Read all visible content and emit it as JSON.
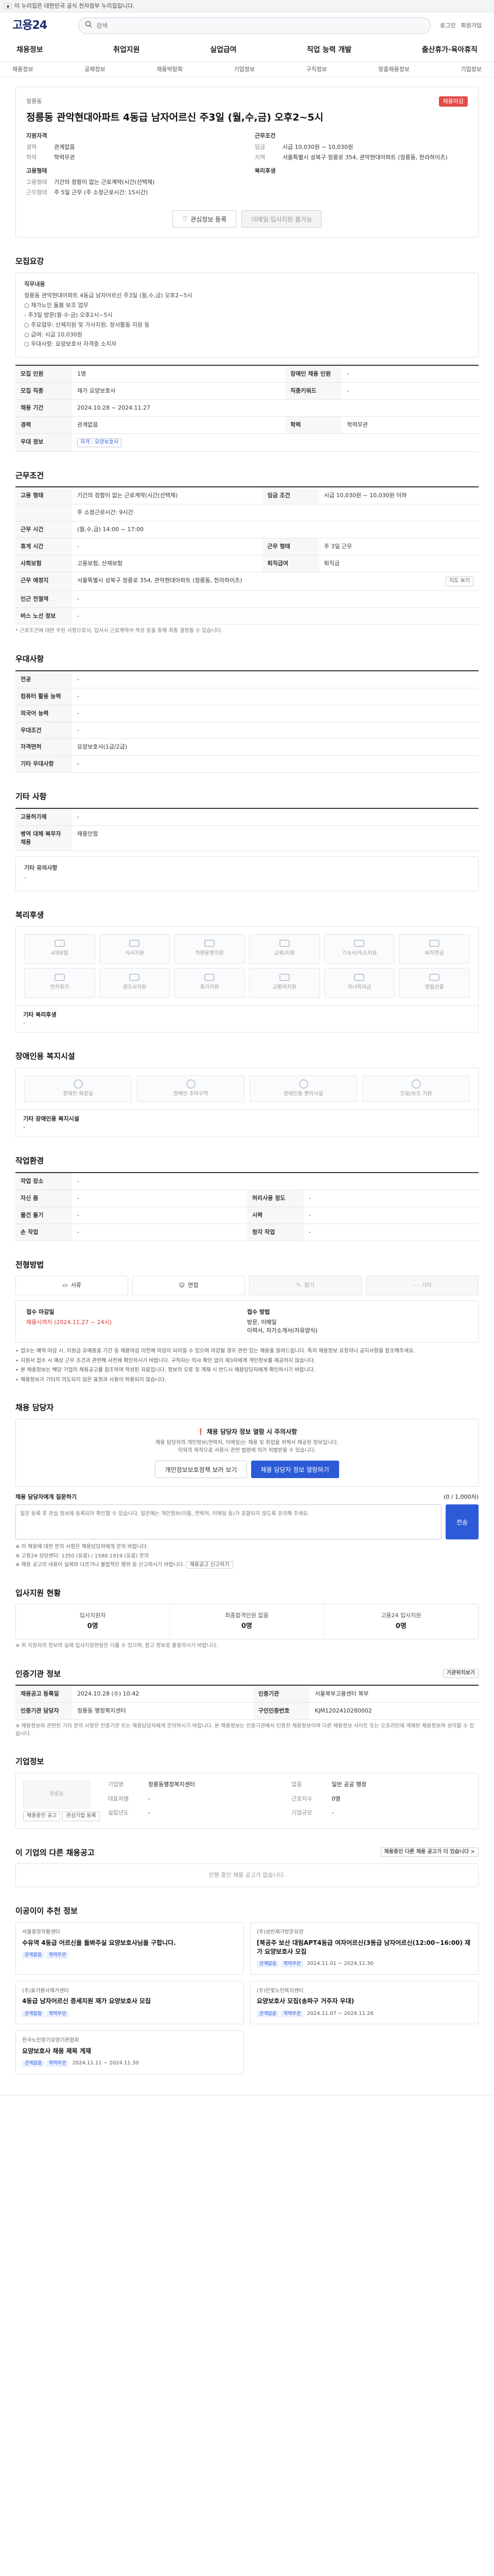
{
  "banner": {
    "text": "이 누리집은 대한민국 공식 전자정부 누리집입니다."
  },
  "header": {
    "logo": "고용24",
    "search_placeholder": "검색",
    "search_value": "",
    "util": [
      "로그인",
      "회원가입"
    ]
  },
  "gnb": [
    "채용정보",
    "취업지원",
    "실업급여",
    "직업 능력 개발",
    "출산휴가·육아휴직"
  ],
  "subnav": [
    "채용정보",
    "공채정보",
    "채용박람회",
    "기업정보",
    "구직정보",
    "맞춤채용정보",
    "기업정보"
  ],
  "job": {
    "org_name": "정릉동",
    "status": "채용마감",
    "title": "정릉동 관악현대아파트 4동급 남자어르신 주3일 (월,수,금) 오후2~5시",
    "left": {
      "heading1": "지원자격",
      "rows1": [
        {
          "k": "경력",
          "v": "관계없음"
        },
        {
          "k": "학력",
          "v": "학력무관"
        }
      ],
      "heading2": "고용형태",
      "rows2": [
        {
          "k": "고용형태",
          "v": "기간의 정함이 없는 근로계약(시간(선택제)"
        },
        {
          "k": "근무형태",
          "v": "주 5일 근무 (주 소정근로시간: 15시간)"
        }
      ]
    },
    "right": {
      "heading1": "근무조건",
      "rows1": [
        {
          "k": "임금",
          "v": "시급 10,030원 ~ 10,030원"
        },
        {
          "k": "지역",
          "v": "서울특별시 성북구 정릉로 354, 관악현대아파트 (정릉동, 한라하이츠)"
        }
      ],
      "heading2": "복리후생",
      "rows2": []
    },
    "btn_scrap": "관심정보 등록",
    "btn_apply": "이메일·입사지원 불가능"
  },
  "recruit": {
    "title": "모집요강",
    "duty_title": "직무내용",
    "duty_lines": [
      "정릉동 관악현대아파트 4동급 남자어르신 주3일 (월,수,금) 오후2~5시",
      "○ 재가노인 돌봄 보조 업무",
      "  - 주3일 방문(월·수·금) 오후2시~5시",
      "○ 주요업무: 신체지원 및 가사지원, 정서활동 지원 등",
      "○ 급여: 시급 10,030원",
      "○ 우대사항: 요양보호사 자격증 소지자"
    ],
    "rows": [
      {
        "k": "모집 인원",
        "v": "1명",
        "k2": "장애인 채용 인원",
        "v2": "-"
      },
      {
        "k": "모집 직종",
        "v": "재가 요양보호사",
        "k2": "직종키워드",
        "v2": "-"
      },
      {
        "k": "채용 기간",
        "v": "2024.10.28 ~ 2024.11.27",
        "k2": "",
        "v2": ""
      },
      {
        "k": "경력",
        "v": "관계없음",
        "k2": "학력",
        "v2": "학력무관"
      },
      {
        "k": "우대 정보",
        "v": "자격 : 요양보호사",
        "k2": "",
        "v2": ""
      }
    ]
  },
  "conditions": {
    "title": "근무조건",
    "rows": [
      {
        "k": "고용 형태",
        "v": "기간의 정함이 없는 근로계약(시간(선택제)",
        "k2": "임금 조건",
        "v2": "시급 10,030원 ~ 10,030원 이하"
      },
      {
        "k": "",
        "v": "주 소정근로시간: 9시간",
        "k2": "",
        "v2": ""
      },
      {
        "k": "근무 시간",
        "v": "(월,수,금) 14:00 ~ 17:00",
        "k2": "",
        "v2": ""
      },
      {
        "k": "휴게 시간",
        "v": "-",
        "k2": "근무 형태",
        "v2": "주 3일 근무"
      },
      {
        "k": "사회보험",
        "v": "고용보험, 산재보험",
        "k2": "퇴직급여",
        "v2": "퇴직금"
      },
      {
        "k": "근무 예정지",
        "v": "서울특별시 성북구 정릉로 354, 관악현대아파트 (정릉동, 한라하이츠)",
        "k2": "",
        "v2": ""
      },
      {
        "k": "인근 전철역",
        "v": "-",
        "k2": "",
        "v2": ""
      },
      {
        "k": "버스 노선 정보",
        "v": "-",
        "k2": "",
        "v2": ""
      }
    ],
    "map_btn": "지도 보기",
    "note": "* 근로조건에 대한 주된 사항으로서, 입사시 근로계약서 작성 등을 통해 최종 결정될 수 있습니다."
  },
  "extra": {
    "title": "우대사항",
    "rows": [
      {
        "k": "전공",
        "v": "-"
      },
      {
        "k": "컴퓨터 활용 능력",
        "v": "-"
      },
      {
        "k": "외국어 능력",
        "v": "-"
      },
      {
        "k": "우대조건",
        "v": "-"
      },
      {
        "k": "자격면허",
        "v": "요양보호사(1급/2급)"
      },
      {
        "k": "기타 우대사항",
        "v": "-"
      }
    ]
  },
  "etc": {
    "title": "기타 사항",
    "rows": [
      {
        "k": "고용허가제",
        "v": "-"
      },
      {
        "k": "병역 대체 복무자 채용",
        "v": "채용안함"
      }
    ],
    "memo_title": "기타 유의사항",
    "memo": "-"
  },
  "welfare": {
    "title": "복리후생",
    "items": [
      "4대보험",
      "식사지원",
      "차량운행지원",
      "교육/지원",
      "기숙사/숙소지원",
      "퇴직연금",
      "연차휴가",
      "경조사지원",
      "휴가지원",
      "교통비지원",
      "자녀학자금",
      "명절선물"
    ],
    "other_label": "기타 복리후생",
    "other_value": "-"
  },
  "disability": {
    "title": "장애인용 복지시설",
    "items": [
      "장애인 화장실",
      "장애인 주차구역",
      "장애인용 편의시설",
      "진료/보조 지원"
    ],
    "other_label": "기타 장애인용 복지시설",
    "other_value": "-"
  },
  "workenv": {
    "title": "작업환경",
    "rows": [
      {
        "k": "작업 장소",
        "v": "-",
        "k2": "",
        "v2": ""
      },
      {
        "k": "자신 몸",
        "v": "-",
        "k2": "허리사용 정도",
        "v2": "-"
      },
      {
        "k": "물건 들기",
        "v": "-",
        "k2": "시력",
        "v2": "-"
      },
      {
        "k": "손 작업",
        "v": "-",
        "k2": "청각 작업",
        "v2": "-"
      }
    ]
  },
  "apply": {
    "title": "전형방법",
    "chips": [
      {
        "label": "서류",
        "on": true
      },
      {
        "label": "면접",
        "on": true
      },
      {
        "label": "필기",
        "on": false
      },
      {
        "label": "기타",
        "on": false
      }
    ],
    "deadline_label": "접수 마감일",
    "deadline_value": "채용시까지 (2024.11.27 ~ 24시)",
    "method_label": "접수 방법",
    "method_value": "방문, 이메일",
    "method_sub": "이력서, 자기소개서(자유양식)",
    "notes": [
      "접수는 예약 마감 시, 지원금 유예종료 기간 등 채용마감 이전에 마감이 되어질 수 있으며 마감될 경우 관련 있는 채용을 알려드립니다. 특히 채용정보 요청자나 공지사항을 참조해주세요.",
      "지원서 접수 시 예상 근무 조건과 관련해 사전에 확인하시기 바랍니다. 구직자는 의사 확인 없이 제3자에게 개인정보를 제공하지 않습니다.",
      "본 채용정보는 해당 기업의 채용공고를 참조하여 작성된 자료입니다. 정보의 오류 및 게재 시 반드시 채용담당자에게 확인하시기 바랍니다.",
      "채용정보가 기타의 의도되지 않은 표현과 사용이 허용되지 않습니다."
    ]
  },
  "contact": {
    "title": "채용 담당자",
    "warn": "채용 담당자 정보 열람 시 주의사항",
    "sub1": "채용 담당자의 개인정보(연락처, 이메일)는 채용 및 취업을 위해서 제공된 정보입니다.",
    "sub2": "이외의 목적으로 사용시 관련 법령에 의거 처벌받을 수 있습니다.",
    "btn_contact": "개인정보보호정책 보러 보기",
    "btn_show": "채용 담당자 정보 열람하기",
    "qna_label": "채용 담당자에게 질문하기",
    "qna_count": "(0 / 1,000자)",
    "qna_placeholder": "질문 등록 후 관심 정보에 등록되어 확인할 수 있습니다. 질문에는 개인정보(이름, 연락처, 이메일 등)가 포함되지 않도록 유의해 주세요.",
    "qna_submit": "전송",
    "notes": [
      "※ 이 채용에 대한 문의 사항은 채용담당자에게 문의 바랍니다.",
      "※ 고용24 상담센터: 1350 (유료) / 1588-1919 (유료) 문의",
      "※ 채용 공고의 내용이 실제와 다르거나 불법적인 행위 등 신고하시기 바랍니다."
    ],
    "report_btn": "채용공고 신고하기"
  },
  "status": {
    "title": "입사지원 현황",
    "stats": [
      {
        "label": "입사지원자",
        "value": "0명"
      },
      {
        "label": "최종합격인원 없음",
        "value": "0명"
      },
      {
        "label": "고용24 입사지원",
        "value": "0명"
      }
    ],
    "note": "※ 위 지원자의 정보와 실제 입사지원현황은 다를 수 있으며, 참고 정보로 활용하시기 바랍니다."
  },
  "agency": {
    "title": "인증기관 정보",
    "map_btn": "기관위치보기",
    "rows": [
      {
        "k": "채용공고 등록일",
        "v": "2024.10.28 (수) 10:42",
        "k2": "인증기관",
        "v2": "서울북부고용센터 북부"
      },
      {
        "k": "인증기관 담당자",
        "v": "정릉동 행정복지센터",
        "k2": "구인인증번호",
        "v2": "KJM1202410280002"
      }
    ],
    "note": "※ 채용정보와 관련된 기타 문의 사항은 인증기관 또는 채용담당자에게 문의하시기 바랍니다. 본 채용정보는 인증기관에서 인증한 채용정보이며 다른 채용정보 사이트 또는 오프라인에 게재된 채용정보와 상이할 수 있습니다."
  },
  "company": {
    "title": "기업정보",
    "logo": "정릉동",
    "info": [
      {
        "k": "기업명",
        "v": "정릉동행정복지센터"
      },
      {
        "k": "업종",
        "v": "일반 공공 행정"
      },
      {
        "k": "대표자명",
        "v": "-"
      },
      {
        "k": "근로자수",
        "v": "0명"
      },
      {
        "k": "설립년도",
        "v": "-"
      },
      {
        "k": "기업규모",
        "v": "-"
      }
    ],
    "btn_more": "채용중인 공고",
    "btn_scrap": "관심기업 등록"
  },
  "others": {
    "title": "이 기업의 다른 채용공고",
    "more": "채용중인 다른 채용 공고가 더 있습니다 >",
    "empty": "진행 중인 채용 공고가 없습니다."
  },
  "recommend": {
    "title": "이공이이 추천 정보",
    "cards": [
      {
        "org": "서울중앙자활센터",
        "title": "수유역 4동급 어르신을 돌봐주실 요양보호사님을 구합니다.",
        "meta1": "관계없음",
        "meta2": "학력무관",
        "date": ""
      },
      {
        "org": "(주)성빈재가방문요양",
        "title": "[북공주 보산 대림APT4동급 여자어르신(3등급 남자어르신(12:00~16:00) 재가 요양보호사 모집",
        "meta1": "관계없음",
        "meta2": "학력무관",
        "date": "2024.11.01 ~ 2024.11.30"
      },
      {
        "org": "(주)효가봉사재가센터",
        "title": "4동급 남자어르신 증세지원 재가 요양보호사 모집",
        "meta1": "관계없음",
        "meta2": "학력무관",
        "date": ""
      },
      {
        "org": "(주)은빛노인복지센터",
        "title": "요양보호사 모집(송파구 거주자 우대)",
        "meta1": "관계없음",
        "meta2": "학력무관",
        "date": "2024.11.07 ~ 2024.11.26"
      },
      {
        "org": "한국노인장기요양기관협회",
        "title": "요양보호사 채용 제목 게재",
        "meta1": "관계없음",
        "meta2": "학력무관",
        "date": "2024.11.11 ~ 2024.11.30"
      }
    ]
  }
}
